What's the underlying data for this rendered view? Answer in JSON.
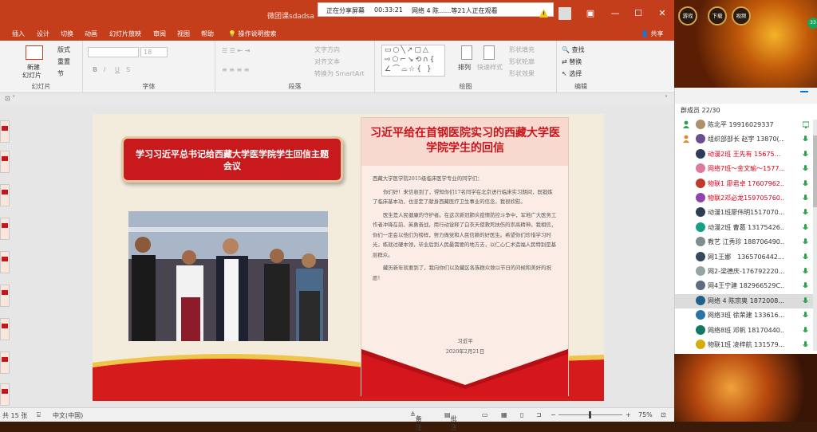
{
  "window": {
    "title": "微团课sdadsa",
    "share_bar": {
      "sharing_label": "正在分享屏幕",
      "timer": "00:33:21",
      "watching": "网络 4 陈......等21人正在观看"
    }
  },
  "menu": {
    "tabs": [
      "插入",
      "设计",
      "切换",
      "动画",
      "幻灯片放映",
      "审阅",
      "视图",
      "帮助"
    ],
    "tell_me": "操作说明搜索",
    "share": "共享"
  },
  "ribbon": {
    "slides_group": {
      "new_slide": "新建",
      "new_slide2": "幻灯片",
      "layout": "版式",
      "reset": "重置",
      "section": "节",
      "label": "幻灯片"
    },
    "font_group": {
      "label": "字体",
      "size": "18"
    },
    "paragraph_group": {
      "label": "段落",
      "text_direction": "文字方向",
      "align_text": "对齐文本",
      "smartart": "转换为 SmartArt"
    },
    "drawing_group": {
      "label": "绘图",
      "arrange": "排列",
      "quick_styles": "快速样式",
      "fill": "形状填充",
      "outline": "形状轮廓",
      "effects": "形状效果"
    },
    "editing_group": {
      "label": "编辑",
      "find": "查找",
      "replace": "替换",
      "select": "选择"
    }
  },
  "slide": {
    "banner": "学习习近平总书记给西藏大学医学院学生回信主题会议",
    "letter_title": "习近平给在首钢医院实习的西藏大学医学院学生的回信",
    "greeting": "西藏大学医学院2015级临床医学专业的同学们：",
    "para1": "你们好！来信收到了，得知你们17名同学在北京进行临床实习期间，既锻炼了临床基本功，也坚定了献身西藏医疗卫生事业的信念，我很欣慰。",
    "para2": "医生是人民健康的守护者。在这次新冠肺炎疫情防控斗争中，军地广大医务工作者冲锋在前、英勇奋战，用行动诠释了白衣天使救死扶伤的崇高精神。我相信，你们一定会以他们为榜样，努力做党和人民信赖的好医生。希望你们珍惜学习时光，练就过硬本领，毕业后到人民最需要的地方去，以仁心仁术造福人民特别是基层群众。",
    "para3": "藏历新年就要到了，我向你们以及藏区各族群众致以节日的问候和美好的祝愿！",
    "signature": "习近平",
    "date": "2020年2月21日"
  },
  "status": {
    "slide_count": "共 15 张",
    "language": "中文(中国)",
    "notes": "备注",
    "comments": "批注",
    "zoom": "75%",
    "zoom_level": 75
  },
  "panel": {
    "member_count": "群成员 22/30",
    "members": [
      {
        "name": "陈北平 19916029337",
        "color": "#333333",
        "avatar": "#b08f6b"
      },
      {
        "name": "组织部部长 赵宇 13870(...",
        "color": "#333333",
        "avatar": "#6a4c93"
      },
      {
        "name": "动漫2班 王先有 15675...",
        "color": "#d9001b",
        "avatar": "#2b3d5b"
      },
      {
        "name": "网络7班～金文瑜～1577...",
        "color": "#d9001b",
        "avatar": "#e07a9c"
      },
      {
        "name": "物联1 廖君卓 17607962...",
        "color": "#d9001b",
        "avatar": "#c0392b"
      },
      {
        "name": "物联2邓必龙159705760...",
        "color": "#d9001b",
        "avatar": "#8e44ad"
      },
      {
        "name": "动漫1班廖伟明1517070...",
        "color": "#333333",
        "avatar": "#2c3e50"
      },
      {
        "name": "动漫2班 曹葛 13175426...",
        "color": "#333333",
        "avatar": "#16a085"
      },
      {
        "name": "教艺 江秀珍 188706490...",
        "color": "#333333",
        "avatar": "#7f8c8d"
      },
      {
        "name": "网1王娜　1365706442...",
        "color": "#333333",
        "avatar": "#34495e"
      },
      {
        "name": "网2-梁德庆-176792220...",
        "color": "#333333",
        "avatar": "#95a5a6"
      },
      {
        "name": "网4王宁建 182966529C...",
        "color": "#333333",
        "avatar": "#5d6d7e"
      },
      {
        "name": "网络 4 陈宗奥 1872008...",
        "color": "#333333",
        "avatar": "#1f618d"
      },
      {
        "name": "网络3班 徐荣建 133616...",
        "color": "#333333",
        "avatar": "#2874a6"
      },
      {
        "name": "网络8班 邓帆 18170440...",
        "color": "#333333",
        "avatar": "#117864"
      },
      {
        "name": "物联1班 凌梓航 131579...",
        "color": "#333333",
        "avatar": "#d4ac0d"
      }
    ]
  },
  "live": {
    "games": "游戏",
    "download": "下载",
    "video": "视频",
    "badge": "33"
  }
}
